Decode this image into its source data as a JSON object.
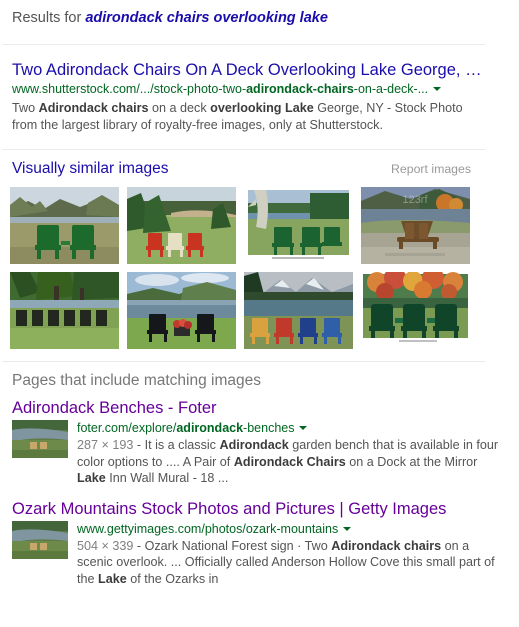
{
  "header": {
    "results_for_label": "Results for",
    "query": "adirondack chairs overlooking lake"
  },
  "best_guess_result": {
    "title": "Two Adirondack Chairs On A Deck Overlooking Lake George, …",
    "url_parts": [
      {
        "text": "www.shutterstock.com/.../stock-photo-two-",
        "bold": false
      },
      {
        "text": "adirondack-chairs",
        "bold": true
      },
      {
        "text": "-on-a-deck-...",
        "bold": false
      }
    ],
    "url_plain": "www.shutterstock.com/.../stock-photo-two-adirondack-chairs-on-a-deck-...",
    "snippet_parts": [
      {
        "text": "Two ",
        "bold": false
      },
      {
        "text": "Adirondack chairs",
        "bold": true
      },
      {
        "text": " on a deck ",
        "bold": false
      },
      {
        "text": "overlooking Lake",
        "bold": true
      },
      {
        "text": " George, NY - Stock Photo from the largest library of royalty-free images, only at Shutterstock.",
        "bold": false
      }
    ],
    "snippet_plain": "Two Adirondack chairs on a deck overlooking Lake George, NY - Stock Photo from the largest library of royalty-free images, only at Shutterstock."
  },
  "visually_similar": {
    "title": "Visually similar images",
    "report_label": "Report images",
    "images": [
      {
        "alt": "Two green Adirondack chairs on grass overlooking a mountain lake",
        "palette": {
          "sky": "#b9c7d2",
          "water": "#8fa3ae",
          "hill": "#6d7a5a",
          "grass": "#9aa martin"
        },
        "scene": "green-chairs-lake-mountains"
      },
      {
        "alt": "Red and cream Adirondack chairs by a pine-lined cove beach",
        "scene": "red-chairs-cove-beach"
      },
      {
        "alt": "Green Adirondack chairs beside a birch tree facing a lake",
        "scene": "green-chairs-birch-lake"
      },
      {
        "alt": "Two wooden Adirondack chairs on a gravel lakeshore in autumn",
        "scene": "wood-chairs-autumn-shore"
      },
      {
        "alt": "Row of dark Adirondack chairs under trees facing a lake",
        "scene": "row-chairs-under-trees"
      },
      {
        "alt": "Two black Adirondack chairs facing a calm lake with hills",
        "scene": "black-chairs-calm-lake"
      },
      {
        "alt": "Four colorful Adirondack chairs facing a mountain lake",
        "scene": "colorful-chairs-mountain-lake"
      },
      {
        "alt": "Three dark green Adirondack chairs under fall foliage",
        "scene": "green-chairs-fall-foliage"
      }
    ]
  },
  "pages_section": {
    "heading": "Pages that include matching images",
    "results": [
      {
        "title": "Adirondack Benches - Foter",
        "url_parts": [
          {
            "text": "foter.com/explore/",
            "bold": false
          },
          {
            "text": "adirondack",
            "bold": true
          },
          {
            "text": "-benches",
            "bold": false
          }
        ],
        "url_plain": "foter.com/explore/adirondack-benches",
        "dimensions": "287 × 193",
        "snippet_parts": [
          {
            "text": " - It is a classic ",
            "bold": false
          },
          {
            "text": "Adirondack",
            "bold": true
          },
          {
            "text": " garden bench that is available in four color options to .... A Pair of ",
            "bold": false
          },
          {
            "text": "Adirondack Chairs",
            "bold": true
          },
          {
            "text": " on a Dock at the Mirror ",
            "bold": false
          },
          {
            "text": "Lake",
            "bold": true
          },
          {
            "text": " Inn Wall Mural - 18 ...",
            "bold": false
          }
        ],
        "snippet_plain": "287 × 193 - It is a classic Adirondack garden bench that is available in four color options to .... A Pair of Adirondack Chairs on a Dock at the Mirror Lake Inn Wall Mural - 18 ...",
        "thumb_alt": "Adirondack chairs on grass beside a river"
      },
      {
        "title": "Ozark Mountains Stock Photos and Pictures | Getty Images",
        "url_parts": [
          {
            "text": "www.gettyimages.com/photos/ozark-mountains",
            "bold": false
          }
        ],
        "url_plain": "www.gettyimages.com/photos/ozark-mountains",
        "dimensions": "504 × 339",
        "snippet_parts": [
          {
            "text": " - Ozark National Forest sign · Two ",
            "bold": false
          },
          {
            "text": "Adirondack chairs",
            "bold": true
          },
          {
            "text": " on a scenic overlook. ... Officially called Anderson Hollow Cove this small part of the ",
            "bold": false
          },
          {
            "text": "Lake",
            "bold": true
          },
          {
            "text": " of the Ozarks in",
            "bold": false
          }
        ],
        "snippet_plain": "504 × 339 - Ozark National Forest sign · Two Adirondack chairs on a scenic overlook. ... Officially called Anderson Hollow Cove this small part of the Lake of the Ozarks in",
        "thumb_alt": "Adirondack chairs on grass beside a river"
      }
    ]
  },
  "colors": {
    "link_blue": "#1a0dab",
    "visited_purple": "#660099",
    "url_green": "#006621",
    "snippet_gray": "#545454",
    "muted_gray": "#777777"
  }
}
